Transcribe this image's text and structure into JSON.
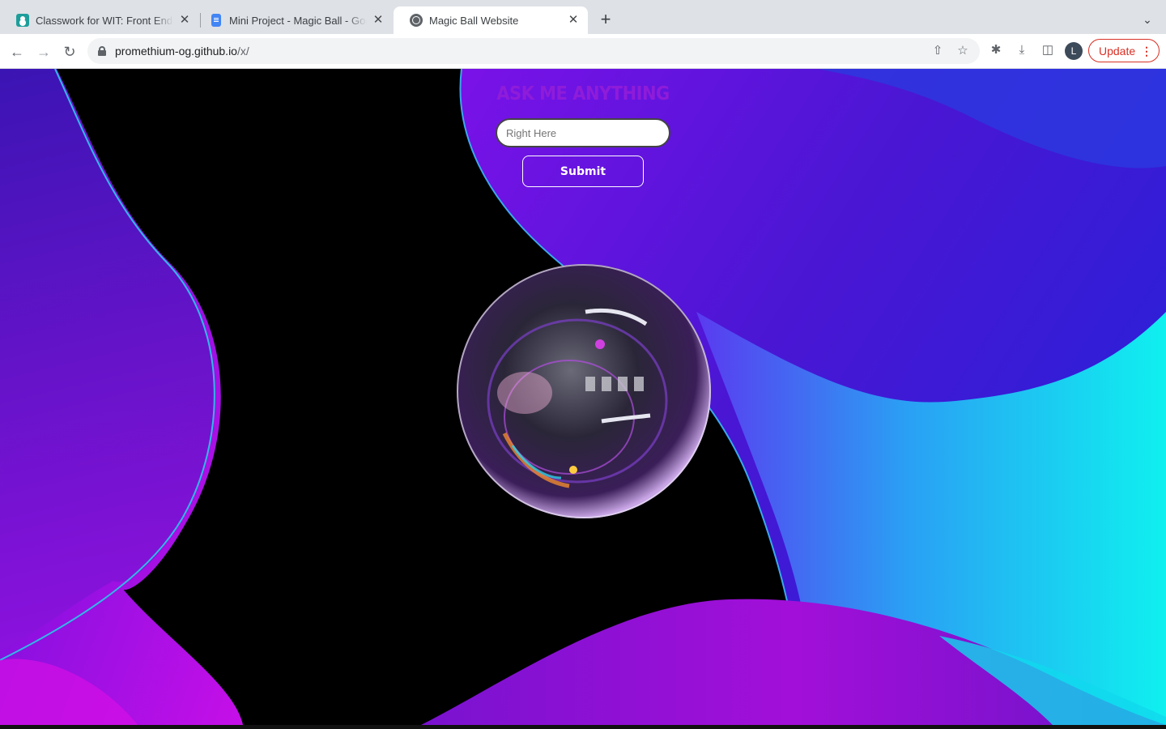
{
  "browser": {
    "tabs": [
      {
        "title": "Classwork for WIT: Front End",
        "favicon": "classroom-icon",
        "active": false
      },
      {
        "title": "Mini Project - Magic Ball - Goo",
        "favicon": "docs-icon",
        "active": false
      },
      {
        "title": "Magic Ball Website",
        "favicon": "globe-icon",
        "active": true
      }
    ],
    "url_host": "promethium-og.github.io",
    "url_path": "/x/",
    "profile_initial": "L",
    "update_label": "Update"
  },
  "page": {
    "heading": "ASK ME ANYTHING",
    "input_placeholder": "Right Here",
    "input_value": "",
    "submit_label": "Submit"
  },
  "colors": {
    "heading": "#8e1cd9",
    "wave_magenta": "#d90fe6",
    "wave_violet": "#7a12e8",
    "wave_blue": "#3316c8",
    "wave_cyan": "#0fe8ec",
    "update_red": "#d93025"
  }
}
